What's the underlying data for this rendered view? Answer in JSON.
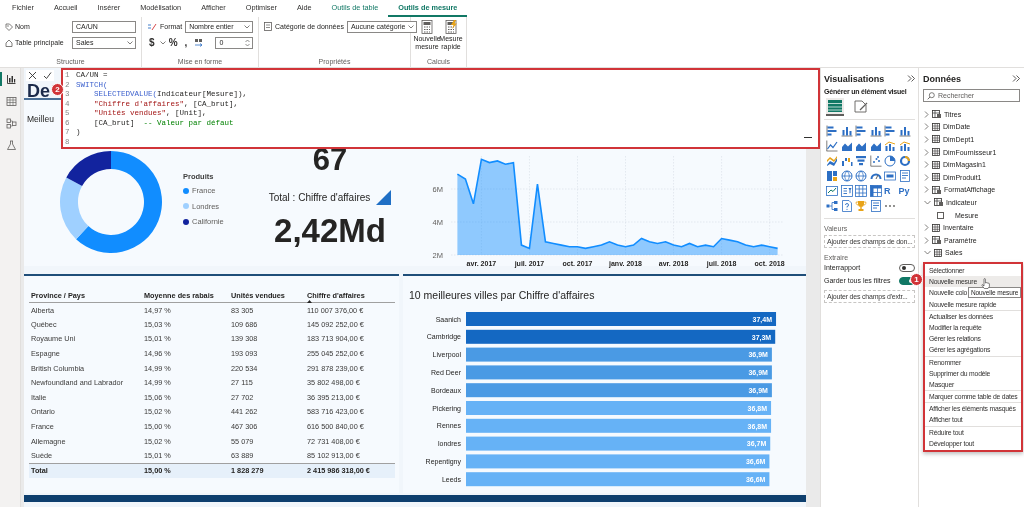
{
  "ribbon": {
    "tabs": [
      {
        "label": "Fichier",
        "selected": false,
        "contextual": false
      },
      {
        "label": "Accueil",
        "selected": false,
        "contextual": false
      },
      {
        "label": "Insérer",
        "selected": false,
        "contextual": false
      },
      {
        "label": "Modélisation",
        "selected": false,
        "contextual": false
      },
      {
        "label": "Afficher",
        "selected": false,
        "contextual": false
      },
      {
        "label": "Optimiser",
        "selected": false,
        "contextual": false
      },
      {
        "label": "Aide",
        "selected": false,
        "contextual": false
      },
      {
        "label": "Outils de table",
        "selected": false,
        "contextual": true
      },
      {
        "label": "Outils de mesure",
        "selected": true,
        "contextual": true
      }
    ],
    "structure": {
      "label": "Structure",
      "name_label": "Nom",
      "name_value": "CA/UN",
      "table_label": "Table principale",
      "table_value": "Sales"
    },
    "formatting": {
      "label": "Mise en forme",
      "format_label": "Format",
      "format_value": "Nombre entier",
      "symbols": [
        "$",
        "%",
        ","
      ],
      "decimals": "0"
    },
    "properties": {
      "label": "Propriétés",
      "category_label": "Catégorie de données",
      "category_value": "Aucune catégorie"
    },
    "calculations": {
      "label": "Calculs",
      "buttons": [
        {
          "kind": "measure",
          "label": "Nouvelle mesure"
        },
        {
          "kind": "quick",
          "label": "Mesure rapide"
        }
      ]
    }
  },
  "nav": [
    {
      "kind": "report",
      "selected": true
    },
    {
      "kind": "table",
      "selected": false
    },
    {
      "kind": "model",
      "selected": false
    },
    {
      "kind": "dax",
      "selected": false
    }
  ],
  "formula_bar": {
    "badge": "2",
    "lines": [
      {
        "number": "1",
        "tokens": [
          {
            "text": "CA/UN =",
            "kind": "plain"
          }
        ]
      },
      {
        "number": "2",
        "tokens": [
          {
            "text": "SWITCH(",
            "kind": "keyword"
          }
        ]
      },
      {
        "number": "3",
        "tokens": [
          {
            "text": "    SELECTEDVALUE(",
            "kind": "keyword"
          },
          {
            "text": "Indicateur[Mesure]),",
            "kind": "plain"
          }
        ]
      },
      {
        "number": "4",
        "tokens": [
          {
            "text": "    \"Chiffre d'affaires\"",
            "kind": "string"
          },
          {
            "text": ", [CA_brut],",
            "kind": "plain"
          }
        ]
      },
      {
        "number": "5",
        "tokens": [
          {
            "text": "    \"Unités vendues\"",
            "kind": "string"
          },
          {
            "text": ", [Unit],",
            "kind": "plain"
          }
        ]
      },
      {
        "number": "6",
        "tokens": [
          {
            "text": "    [CA_brut]  ",
            "kind": "plain"
          },
          {
            "text": "-- Valeur par défaut",
            "kind": "comment"
          }
        ]
      },
      {
        "number": "7",
        "tokens": [
          {
            "text": ")",
            "kind": "plain"
          }
        ]
      },
      {
        "number": "8"
      }
    ]
  },
  "report": {
    "title": "De",
    "panel_title": "Meilleu",
    "legend": {
      "title": "Produits",
      "items": [
        {
          "label": "France",
          "color": "#118dff"
        },
        {
          "label": "Londres",
          "color": "#9fd0ff"
        },
        {
          "label": "Californie",
          "color": "#12239e"
        }
      ]
    },
    "kpi": {
      "value": "67",
      "label": "Total : Chiffre d'affaires",
      "total": "2,42Md"
    },
    "line_chart": {
      "chart_data": {
        "type": "area",
        "grid": true,
        "ylim": [
          2,
          8
        ],
        "yticks": [
          {
            "value": 2,
            "label": "2M"
          },
          {
            "value": 4,
            "label": "4M"
          },
          {
            "value": 6,
            "label": "6M"
          }
        ],
        "categories": [
          null,
          null,
          null,
          "avr. 2017",
          null,
          null,
          null,
          null,
          null,
          "juil. 2017",
          null,
          null,
          null,
          null,
          null,
          "oct. 2017",
          null,
          null,
          null,
          null,
          null,
          "janv. 2018",
          null,
          null,
          null,
          null,
          null,
          "avr. 2018",
          null,
          null,
          null,
          null,
          null,
          "juil. 2018",
          null,
          null,
          null,
          null,
          null,
          "oct. 2018",
          null
        ],
        "series": [
          {
            "color": "#118dff",
            "values": [
              6.9,
              6.6,
              5.1,
              7.8,
              7.6,
              7.7,
              7.5,
              7.6,
              2.6,
              2.4,
              6.3,
              2.8,
              2.7,
              2.6,
              2.5,
              2.5,
              2.4,
              2.5,
              2.6,
              2.8,
              2.6,
              2.5,
              2.6,
              3.0,
              2.8,
              2.7,
              2.8,
              2.6,
              2.5,
              2.7,
              2.5,
              2.6,
              2.5,
              3.0,
              2.9,
              2.8,
              2.6,
              2.5,
              2.6,
              2.5,
              2.4
            ]
          }
        ]
      }
    },
    "table": {
      "columns": [
        {
          "label": "Province / Pays",
          "sorted": false
        },
        {
          "label": "Moyenne des rabais",
          "sorted": false
        },
        {
          "label": "Unités vendues",
          "sorted": false
        },
        {
          "label": "Chiffre d'affaires",
          "sorted": true
        }
      ],
      "rows": [
        [
          "Alberta",
          "14,97 %",
          "83 305",
          "110 007 376,00 €"
        ],
        [
          "Québec",
          "15,03 %",
          "109 686",
          "145 092 252,00 €"
        ],
        [
          "Royaume Uni",
          "15,01 %",
          "139 308",
          "183 713 904,00 €"
        ],
        [
          "Espagne",
          "14,96 %",
          "193 093",
          "255 045 252,00 €"
        ],
        [
          "British Columbia",
          "14,99 %",
          "220 534",
          "291 878 239,00 €"
        ],
        [
          "Newfoundland and Labrador",
          "14,99 %",
          "27 115",
          "35 802 498,00 €"
        ],
        [
          "Italie",
          "15,06 %",
          "27 702",
          "36 395 213,00 €"
        ],
        [
          "Ontario",
          "15,02 %",
          "441 262",
          "583 716 423,00 €"
        ],
        [
          "France",
          "15,00 %",
          "467 306",
          "616 500 840,00 €"
        ],
        [
          "Allemagne",
          "15,02 %",
          "55 079",
          "72 731 408,00 €"
        ],
        [
          "Suède",
          "15,01 %",
          "63 889",
          "85 102 913,00 €"
        ]
      ],
      "total": [
        "Total",
        "15,00 %",
        "1 828 279",
        "2 415 986 318,00 €"
      ]
    },
    "bar_chart": {
      "chart_data": {
        "type": "bar",
        "orientation": "horizontal",
        "title": "10 meilleures villes par Chiffre d'affaires",
        "categories": [
          "Saanich",
          "Cambridge",
          "Liverpool",
          "Red Deer",
          "Bordeaux",
          "Pickering",
          "Rennes",
          "londres",
          "Repentigny",
          "Leeds"
        ],
        "values": [
          37.4,
          37.3,
          36.9,
          36.9,
          36.9,
          36.8,
          36.8,
          36.7,
          36.6,
          36.6
        ],
        "value_labels": [
          "37,4M",
          "37,3M",
          "36,9M",
          "36,9M",
          "36,9M",
          "36,8M",
          "36,8M",
          "36,7M",
          "36,6M",
          "36,6M"
        ]
      }
    }
  },
  "visualizations": {
    "title": "Visualisations",
    "subtitle": "Générer un élément visuel",
    "modes": [
      {
        "kind": "build",
        "selected": true
      },
      {
        "kind": "format",
        "selected": false
      }
    ],
    "visuals": [
      {
        "kind": "hbar"
      },
      {
        "kind": "vbar"
      },
      {
        "kind": "hbar"
      },
      {
        "kind": "vbar"
      },
      {
        "kind": "hbar"
      },
      {
        "kind": "vbar"
      },
      {
        "kind": "line"
      },
      {
        "kind": "area"
      },
      {
        "kind": "area"
      },
      {
        "kind": "area"
      },
      {
        "kind": "combo"
      },
      {
        "kind": "combo"
      },
      {
        "kind": "ribbon"
      },
      {
        "kind": "waterfall"
      },
      {
        "kind": "funnel"
      },
      {
        "kind": "scatter"
      },
      {
        "kind": "pie"
      },
      {
        "kind": "donut"
      },
      {
        "kind": "treemap"
      },
      {
        "kind": "map"
      },
      {
        "kind": "map"
      },
      {
        "kind": "gauge"
      },
      {
        "kind": "card"
      },
      {
        "kind": "narrative"
      },
      {
        "kind": "kpi"
      },
      {
        "kind": "slicer"
      },
      {
        "kind": "table"
      },
      {
        "kind": "matrix"
      },
      {
        "kind": "script",
        "label": "R"
      },
      {
        "kind": "script",
        "label": "Py"
      },
      {
        "kind": "tree"
      },
      {
        "kind": "qa"
      },
      {
        "kind": "trophy"
      },
      {
        "kind": "narrative"
      },
      {
        "kind": "more"
      }
    ],
    "values_label": "Valeurs",
    "values_well": "Ajouter des champs de don...",
    "drill_label": "Extraire",
    "toggles": [
      {
        "label": "Interrapport",
        "on": false
      },
      {
        "label": "Garder tous les filtres",
        "on": true
      }
    ],
    "drill_well": "Ajouter des champs d'extr..."
  },
  "data": {
    "title": "Données",
    "search": {
      "placeholder": "Rechercher"
    },
    "tables": [
      {
        "label": "Titres",
        "kind": "calc",
        "expanded": false
      },
      {
        "label": "DimDate",
        "kind": "table",
        "expanded": false
      },
      {
        "label": "DimDept1",
        "kind": "table",
        "expanded": false
      },
      {
        "label": "DimFournisseur1",
        "kind": "table",
        "expanded": false
      },
      {
        "label": "DimMagasin1",
        "kind": "table",
        "expanded": false
      },
      {
        "label": "DimProduit1",
        "kind": "table",
        "expanded": false
      },
      {
        "label": "FormatAffichage",
        "kind": "calc",
        "expanded": false
      },
      {
        "label": "Indicateur",
        "kind": "calc",
        "expanded": true,
        "children": [
          {
            "label": "Mesure",
            "checked": false
          }
        ]
      },
      {
        "label": "Inventaire",
        "kind": "table",
        "expanded": false
      },
      {
        "label": "Paramètre",
        "kind": "calc",
        "expanded": false
      },
      {
        "label": "Sales",
        "kind": "table",
        "expanded": true
      }
    ]
  },
  "context_menu": {
    "badge": "1",
    "tooltip": "Nouvelle mesure",
    "groups": [
      {
        "items": [
          {
            "label": "Sélectionner",
            "hovered": false
          },
          {
            "label": "Nouvelle mesure",
            "hovered": true
          },
          {
            "label": "Nouvelle colo",
            "hovered": false
          },
          {
            "label": "Nouvelle mesure rapide",
            "hovered": false
          }
        ]
      },
      {
        "items": [
          {
            "label": "Actualiser les données",
            "hovered": false
          },
          {
            "label": "Modifier la requête",
            "hovered": false
          },
          {
            "label": "Gérer les relations",
            "hovered": false
          },
          {
            "label": "Gérer les agrégations",
            "hovered": false
          }
        ]
      },
      {
        "items": [
          {
            "label": "Renommer",
            "hovered": false
          },
          {
            "label": "Supprimer du modèle",
            "hovered": false
          },
          {
            "label": "Masquer",
            "hovered": false
          }
        ]
      },
      {
        "items": [
          {
            "label": "Marquer comme table de dates",
            "hovered": false
          }
        ]
      },
      {
        "items": [
          {
            "label": "Afficher les éléments masqués",
            "hovered": false
          },
          {
            "label": "Afficher tout",
            "hovered": false
          }
        ]
      },
      {
        "items": [
          {
            "label": "Réduire tout",
            "hovered": false
          },
          {
            "label": "Développer tout",
            "hovered": false
          }
        ]
      }
    ]
  }
}
